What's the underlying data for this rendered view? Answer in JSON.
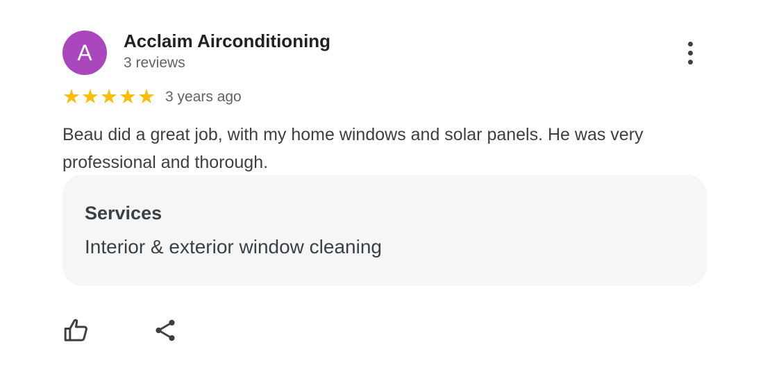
{
  "review": {
    "avatar_letter": "A",
    "avatar_color": "#ab47bc",
    "author_name": "Acclaim Airconditioning",
    "review_count": "3 reviews",
    "rating": 5,
    "rating_max": 5,
    "star_char": "★",
    "star_color": "#fbbc04",
    "time_ago": "3 years ago",
    "text": "Beau did a great job, with my home windows and solar panels. He was very professional and thorough.",
    "services": {
      "title": "Services",
      "value": "Interior & exterior window cleaning"
    },
    "icons": {
      "more": "more-vert-icon",
      "like": "thumb-up-icon",
      "share": "share-icon"
    }
  }
}
